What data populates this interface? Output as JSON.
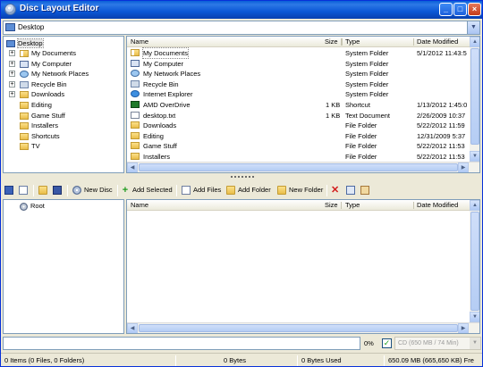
{
  "window": {
    "title": "Disc Layout Editor"
  },
  "address": {
    "value": "Desktop"
  },
  "tree": {
    "root": "Desktop",
    "items": [
      {
        "label": "My Documents",
        "expandable": true,
        "icon": "my-documents-icon"
      },
      {
        "label": "My Computer",
        "expandable": true,
        "icon": "my-computer-icon"
      },
      {
        "label": "My Network Places",
        "expandable": true,
        "icon": "network-places-icon"
      },
      {
        "label": "Recycle Bin",
        "expandable": true,
        "icon": "recycle-bin-icon"
      },
      {
        "label": "Downloads",
        "expandable": true,
        "icon": "folder-icon"
      },
      {
        "label": "Editing",
        "expandable": false,
        "icon": "folder-icon"
      },
      {
        "label": "Game Stuff",
        "expandable": false,
        "icon": "folder-icon"
      },
      {
        "label": "Installers",
        "expandable": false,
        "icon": "folder-icon"
      },
      {
        "label": "Shortcuts",
        "expandable": false,
        "icon": "folder-icon"
      },
      {
        "label": "TV",
        "expandable": false,
        "icon": "folder-icon"
      }
    ]
  },
  "file_list": {
    "columns": {
      "name": "Name",
      "size": "Size",
      "type": "Type",
      "date": "Date Modified"
    },
    "rows": [
      {
        "name": "My Documents",
        "size": "",
        "type": "System Folder",
        "date": "5/1/2012 11:43:5",
        "icon": "my-documents-icon"
      },
      {
        "name": "My Computer",
        "size": "",
        "type": "System Folder",
        "date": "",
        "icon": "my-computer-icon"
      },
      {
        "name": "My Network Places",
        "size": "",
        "type": "System Folder",
        "date": "",
        "icon": "network-places-icon"
      },
      {
        "name": "Recycle Bin",
        "size": "",
        "type": "System Folder",
        "date": "",
        "icon": "recycle-bin-icon"
      },
      {
        "name": "Internet Explorer",
        "size": "",
        "type": "System Folder",
        "date": "",
        "icon": "internet-explorer-icon"
      },
      {
        "name": "AMD OverDrive",
        "size": "1 KB",
        "type": "Shortcut",
        "date": "1/13/2012 1:45:0",
        "icon": "amd-icon"
      },
      {
        "name": "desktop.txt",
        "size": "1 KB",
        "type": "Text Document",
        "date": "2/26/2009 10:37",
        "icon": "text-file-icon"
      },
      {
        "name": "Downloads",
        "size": "",
        "type": "File Folder",
        "date": "5/22/2012 11:59",
        "icon": "folder-icon"
      },
      {
        "name": "Editing",
        "size": "",
        "type": "File Folder",
        "date": "12/31/2009 5:37",
        "icon": "folder-icon"
      },
      {
        "name": "Game Stuff",
        "size": "",
        "type": "File Folder",
        "date": "5/22/2012 11:53",
        "icon": "folder-icon"
      },
      {
        "name": "Installers",
        "size": "",
        "type": "File Folder",
        "date": "5/22/2012 11:53",
        "icon": "folder-icon"
      }
    ]
  },
  "toolbar": {
    "new_disc": "New Disc",
    "add_selected": "Add Selected",
    "add_files": "Add Files",
    "add_folder": "Add Folder",
    "new_folder": "New Folder"
  },
  "disc_tree": {
    "root": "Root"
  },
  "disc_list": {
    "columns": {
      "name": "Name",
      "size": "Size",
      "type": "Type",
      "date": "Date Modified"
    }
  },
  "progress": {
    "percent_text": "0%",
    "value": 0
  },
  "disc_type": {
    "selected": "CD (650 MB / 74 Min)",
    "checked": true
  },
  "status": {
    "items": "0 Items (0 Files, 0 Folders)",
    "bytes": "0 Bytes",
    "bytes_used": "0 Bytes Used",
    "free": "650.09 MB (665,650 KB) Fre"
  },
  "colors": {
    "titlebar": "#0a5fd8",
    "selection": "#e8e8e8",
    "folder": "#e9be4a"
  }
}
